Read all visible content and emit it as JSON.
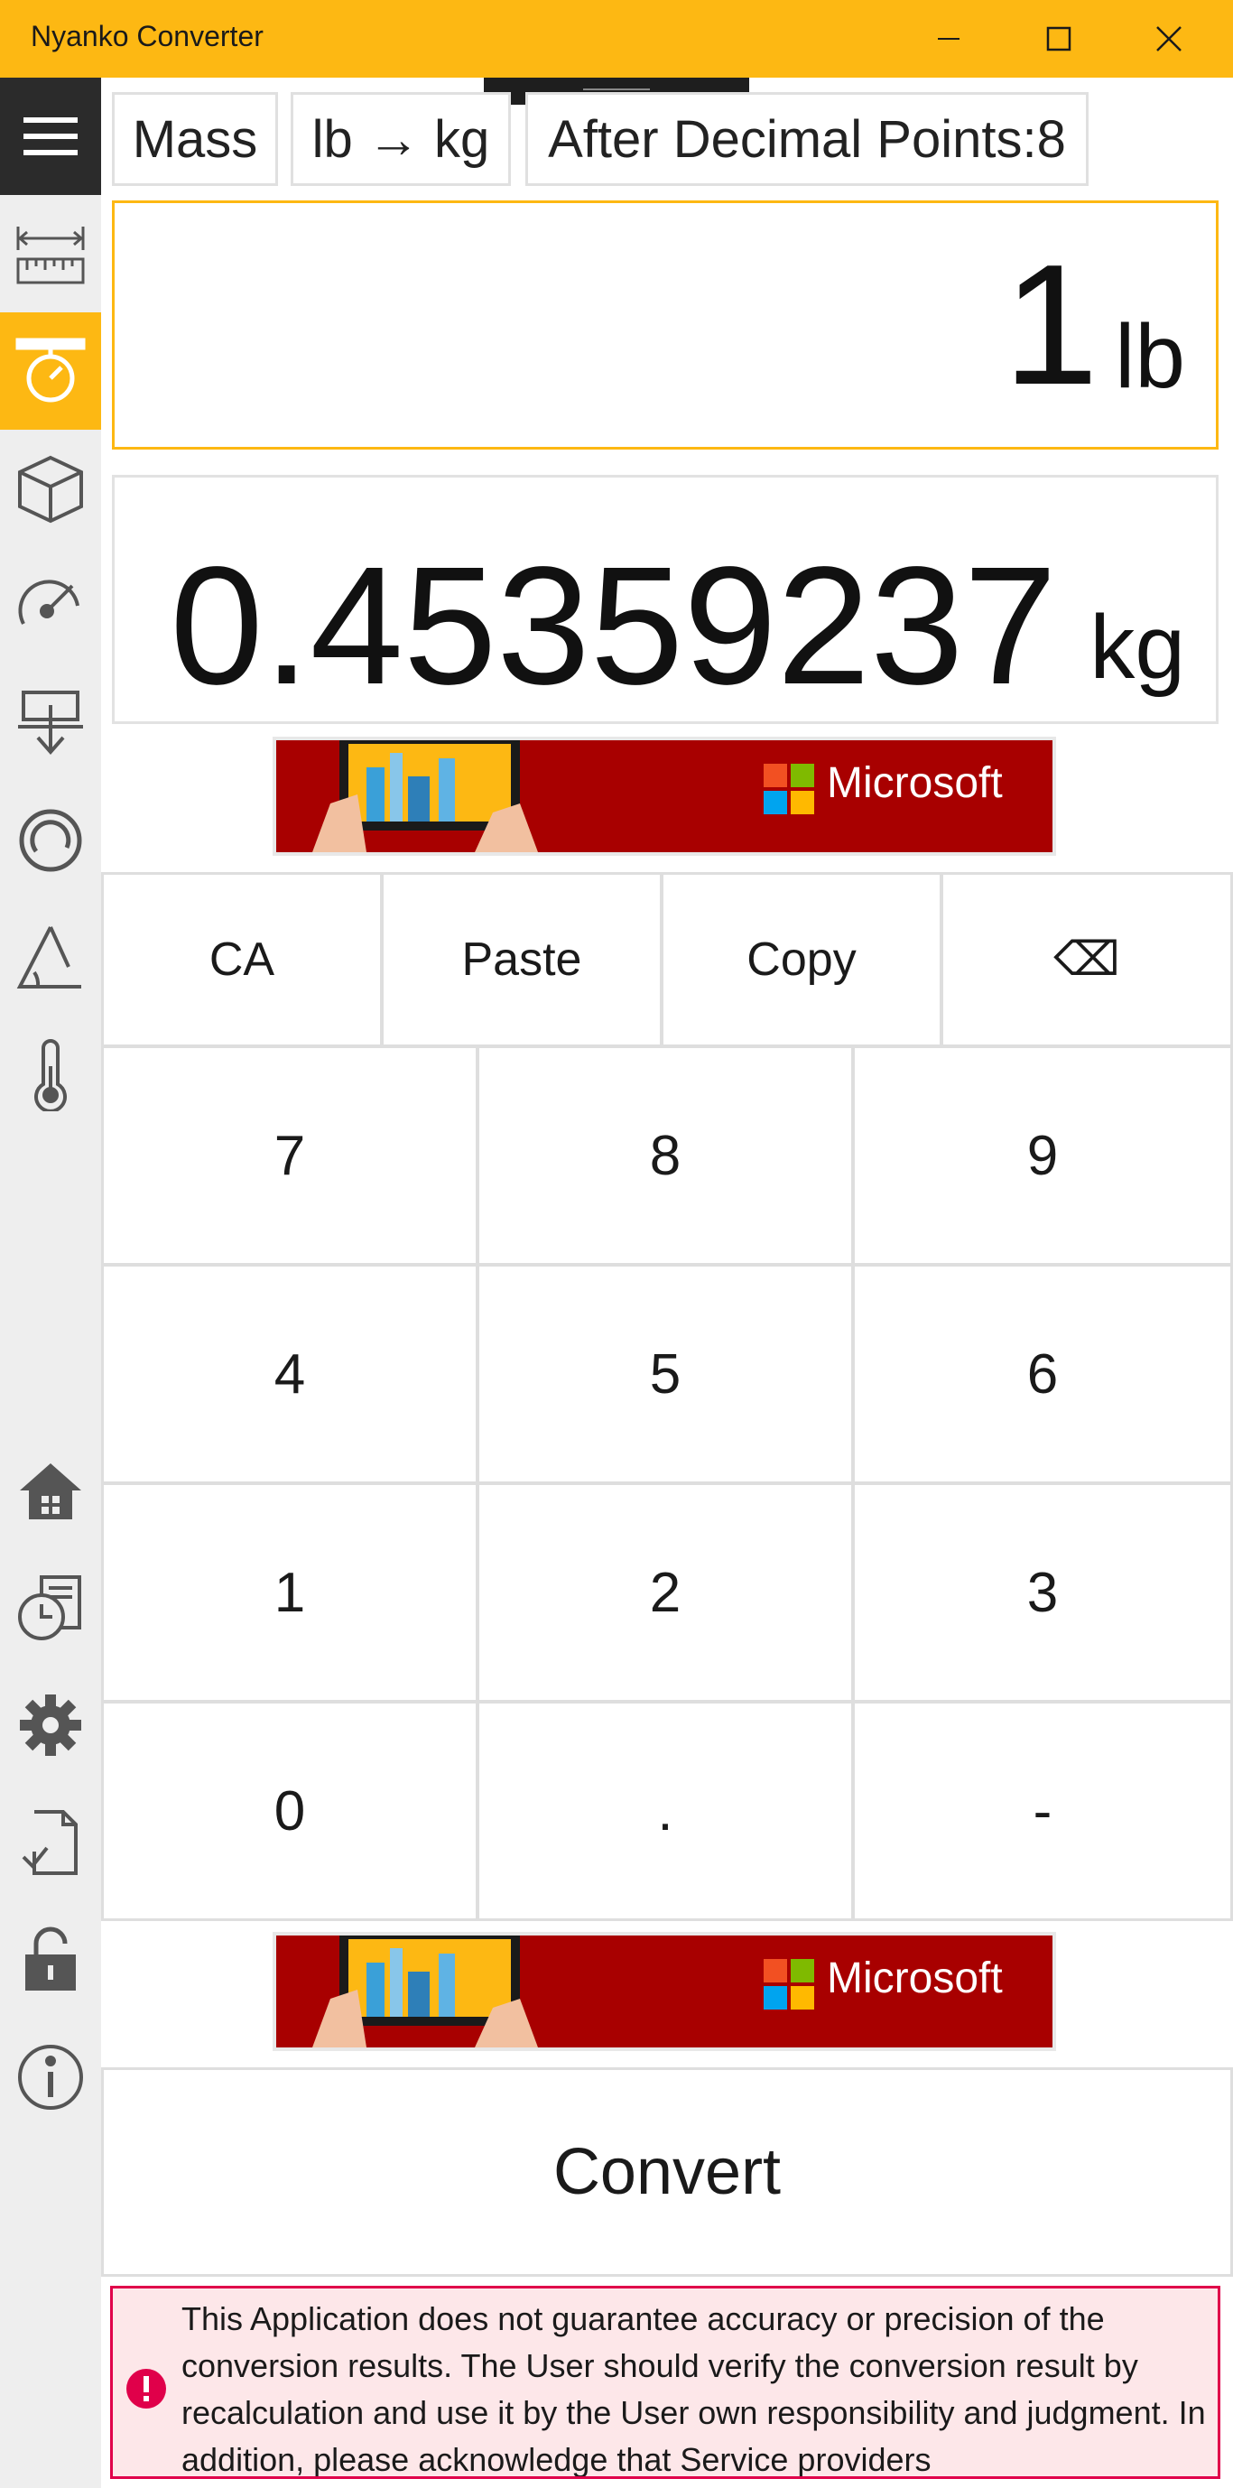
{
  "window": {
    "title": "Nyanko Converter",
    "minimize_icon": "minimize-icon",
    "maximize_icon": "maximize-icon",
    "close_icon": "close-icon"
  },
  "sidebar": {
    "items": [
      {
        "icon": "hamburger-menu-icon"
      },
      {
        "icon": "length-ruler-icon"
      },
      {
        "icon": "mass-scale-icon",
        "active": true
      },
      {
        "icon": "volume-cube-icon"
      },
      {
        "icon": "speed-gauge-icon"
      },
      {
        "icon": "pressure-icon"
      },
      {
        "icon": "circular-icon"
      },
      {
        "icon": "angle-icon"
      },
      {
        "icon": "temperature-icon"
      },
      {
        "icon": "home-icon"
      },
      {
        "icon": "history-icon"
      },
      {
        "icon": "settings-gear-icon"
      },
      {
        "icon": "document-check-icon"
      },
      {
        "icon": "unlock-icon"
      },
      {
        "icon": "info-icon"
      }
    ]
  },
  "selectors": {
    "category": "Mass",
    "units": "lb → kg",
    "decimal": "After Decimal Points:8"
  },
  "input": {
    "value": "1",
    "unit": "lb"
  },
  "output": {
    "value": "0.45359237",
    "unit": "kg"
  },
  "ad": {
    "brand": "Microsoft"
  },
  "keypad": {
    "func": [
      "CA",
      "Paste",
      "Copy",
      "⌫"
    ],
    "row1": [
      "7",
      "8",
      "9"
    ],
    "row2": [
      "4",
      "5",
      "6"
    ],
    "row3": [
      "1",
      "2",
      "3"
    ],
    "row4": [
      "0",
      ".",
      "-"
    ]
  },
  "convert_label": "Convert",
  "notice": {
    "icon": "error-icon",
    "text": "This Application does not guarantee accuracy or precision of the conversion results. The User should verify the conversion result by recalculation and use it by the User own responsibility and judgment. In addition, please acknowledge that Service providers"
  },
  "colors": {
    "accent": "#fdb813",
    "sidebar_dark": "#2b2b2b",
    "ad_red": "#a80000",
    "error_red": "#e0004a"
  }
}
